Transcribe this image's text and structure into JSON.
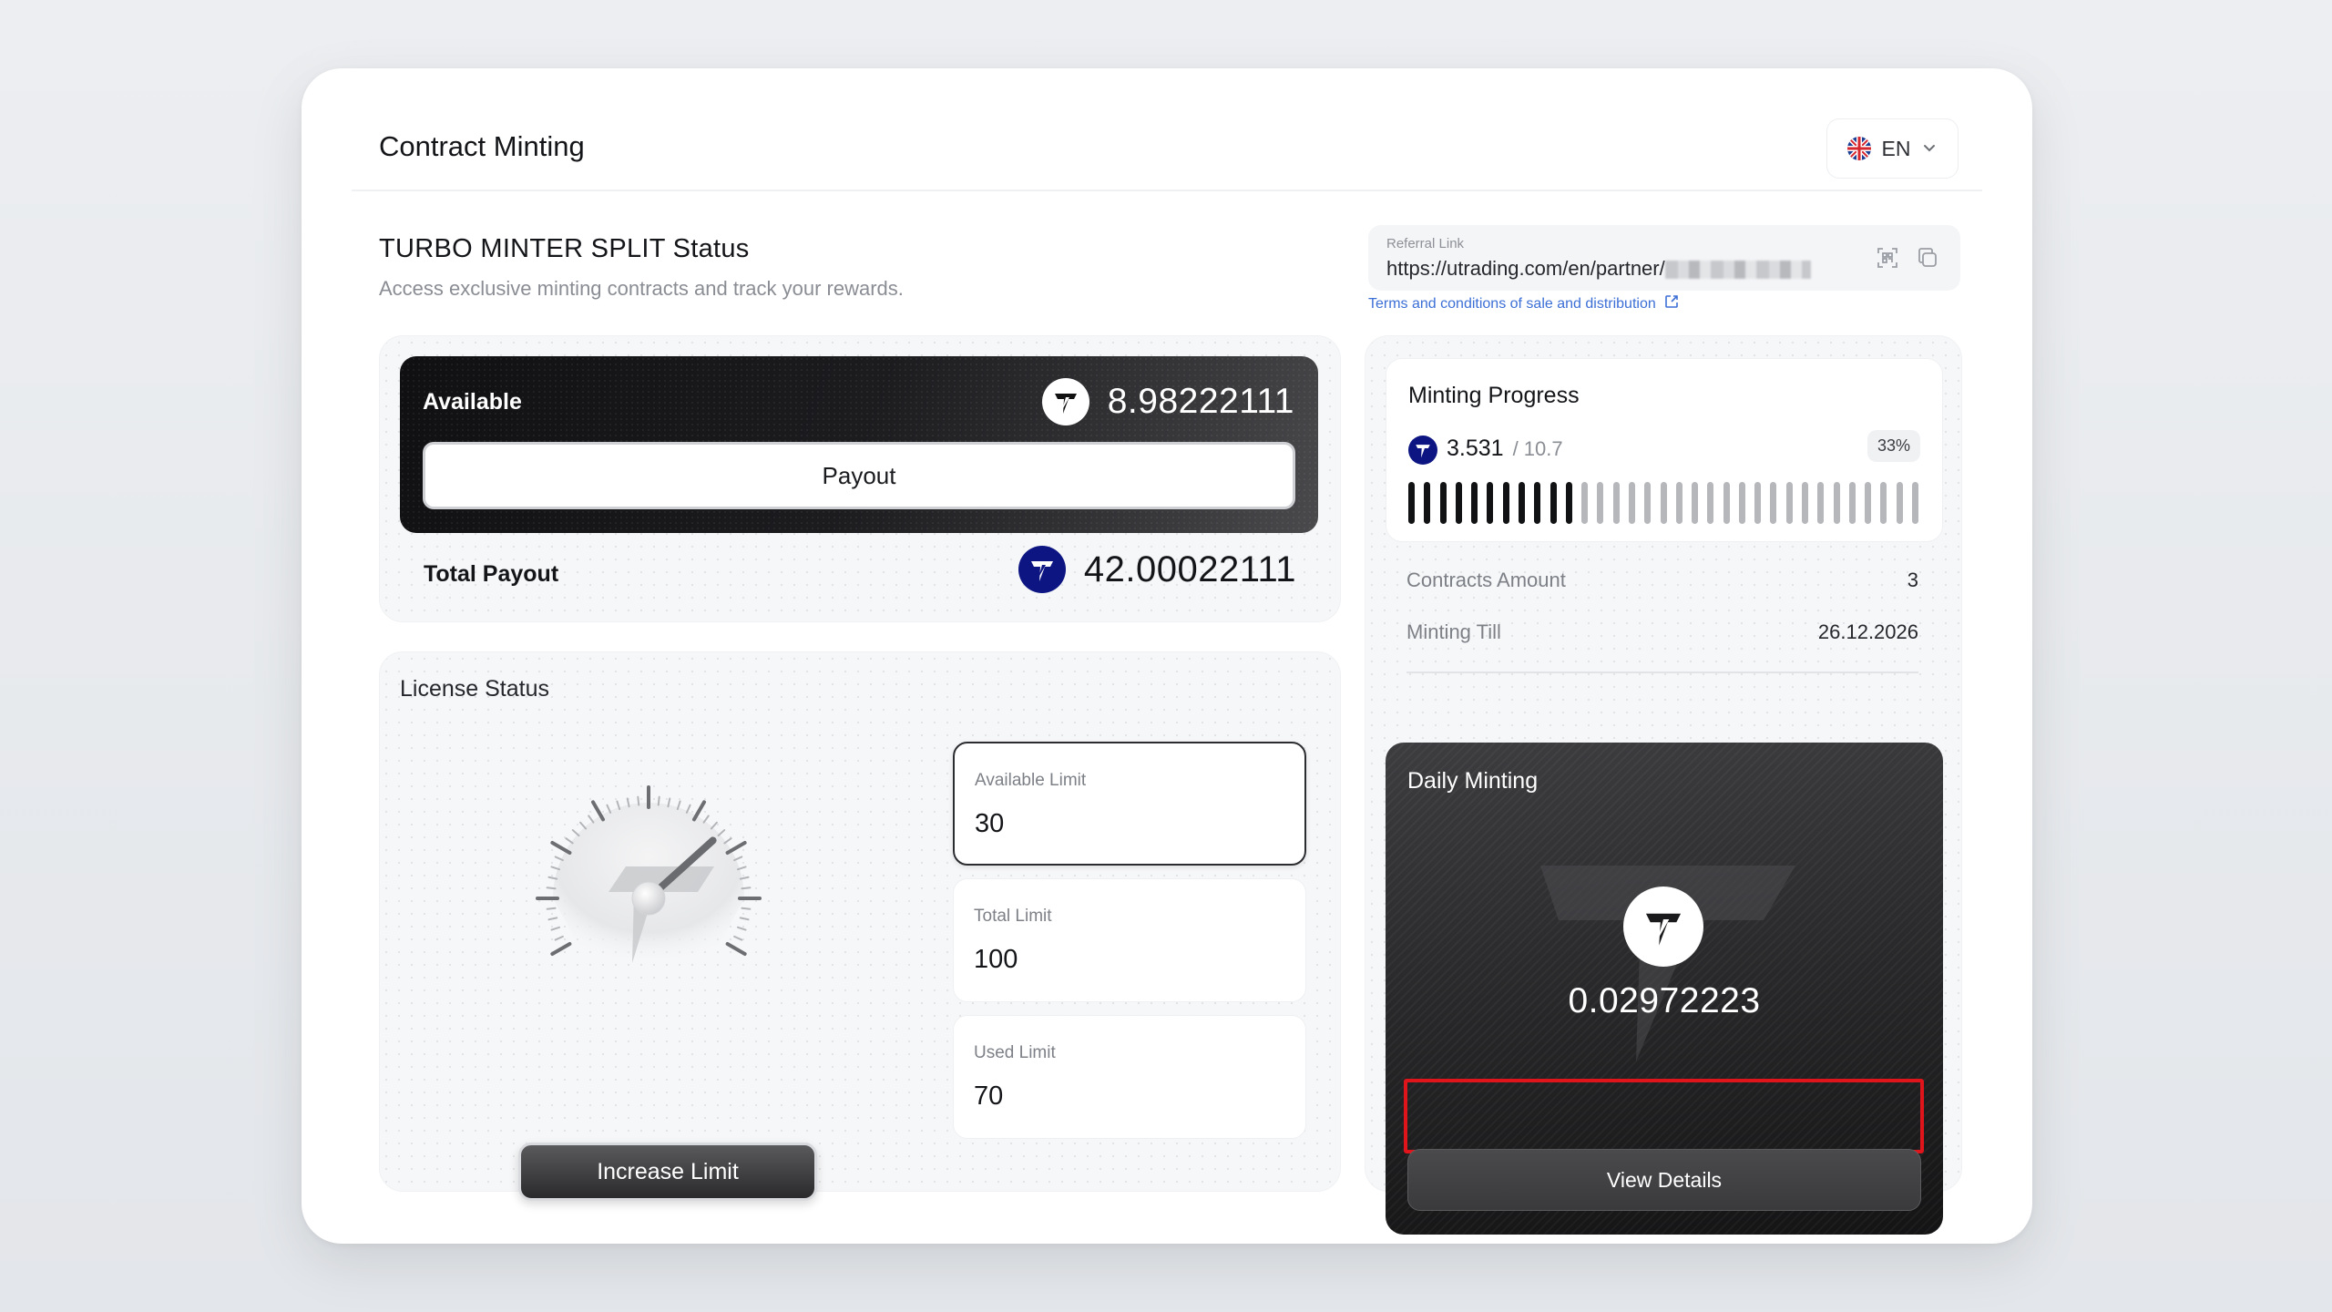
{
  "header": {
    "title": "Contract Minting",
    "language": "EN"
  },
  "status": {
    "title": "TURBO MINTER SPLIT Status",
    "subtitle": "Access exclusive minting contracts and track your rewards."
  },
  "referral": {
    "label": "Referral Link",
    "url": "https://utrading.com/en/partner/",
    "terms": "Terms and conditions of sale and distribution"
  },
  "balance": {
    "available_label": "Available",
    "available_value": "8.98222111",
    "payout_label": "Payout",
    "total_label": "Total Payout",
    "total_value": "42.00022111"
  },
  "license": {
    "title": "License Status",
    "increase_label": "Increase Limit",
    "gauge_level": 0.7,
    "limits": [
      {
        "label": "Available Limit",
        "value": "30"
      },
      {
        "label": "Total Limit",
        "value": "100"
      },
      {
        "label": "Used Limit",
        "value": "70"
      }
    ]
  },
  "progress": {
    "title": "Minting Progress",
    "current": "3.531",
    "max": "/ 10.7",
    "percent": "33%",
    "percent_value": 0.33,
    "bar_count": 33,
    "bars_filled": 11,
    "contracts_label": "Contracts Amount",
    "contracts_value": "3",
    "minting_till_label": "Minting Till",
    "minting_till_value": "26.12.2026"
  },
  "daily": {
    "title": "Daily Minting",
    "value": "0.02972223",
    "view_details_label": "View Details"
  },
  "colors": {
    "brand": "#0d1582",
    "dark": "#141518",
    "highlight": "#e0151b",
    "link": "#3c6fd6"
  }
}
